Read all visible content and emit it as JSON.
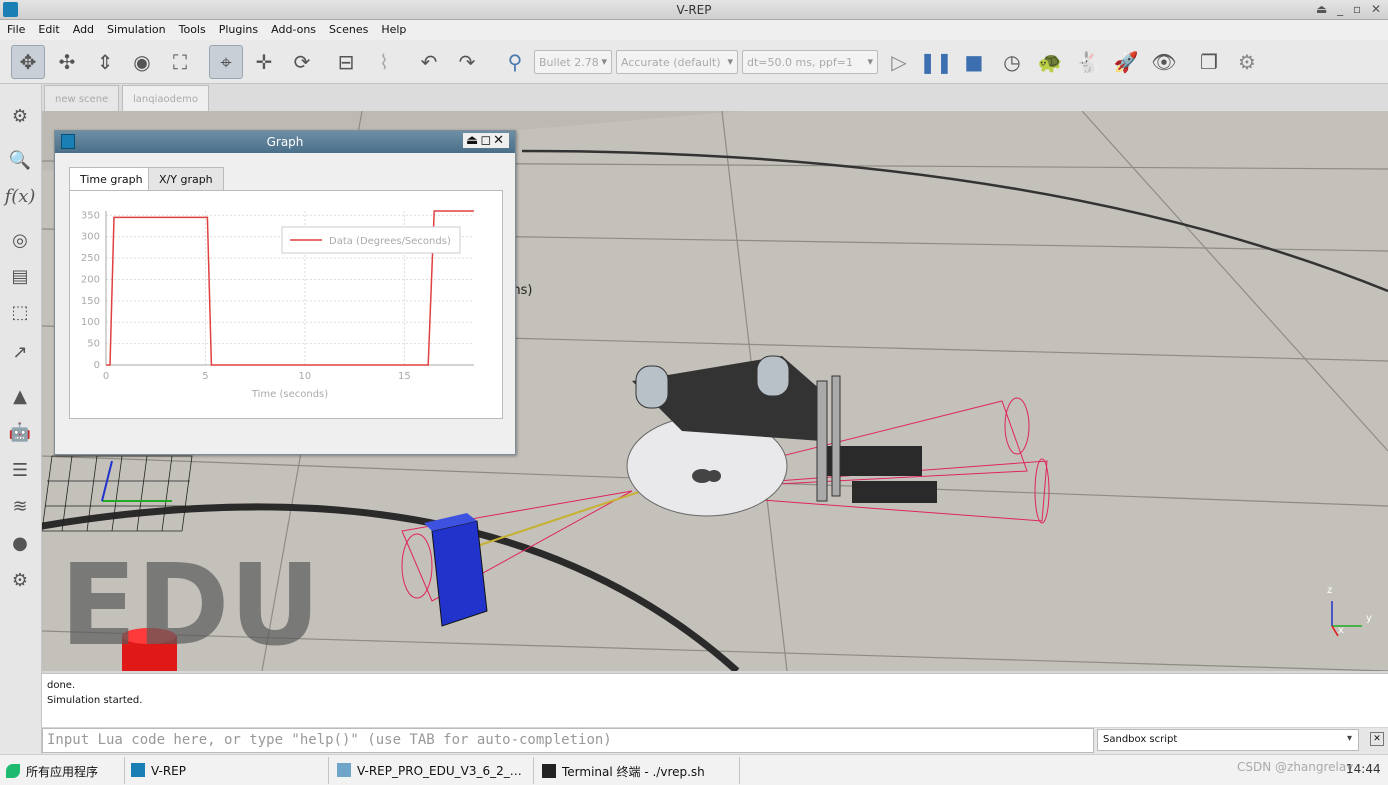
{
  "window": {
    "title": "V-REP"
  },
  "menu": [
    "File",
    "Edit",
    "Add",
    "Simulation",
    "Tools",
    "Plugins",
    "Add-ons",
    "Scenes",
    "Help"
  ],
  "toolbar": {
    "engine": "Bullet 2.78",
    "accuracy": "Accurate (default)",
    "timestep": "dt=50.0 ms, ppf=1"
  },
  "scene_tabs": [
    "new scene",
    "lanqiaodemo"
  ],
  "graph": {
    "title": "Graph",
    "tabs": [
      "Time graph",
      "X/Y graph"
    ],
    "legend": "Data (Degrees/Seconds)",
    "yticks": [
      "350",
      "300",
      "250",
      "200",
      "150",
      "100",
      "50",
      "0"
    ],
    "xticks": [
      "0",
      "5",
      "10",
      "15"
    ],
    "xlabel": "Time (seconds)"
  },
  "chart_data": {
    "type": "line",
    "xlabel": "Time (seconds)",
    "ylabel": "",
    "xlim": [
      0,
      18.5
    ],
    "ylim": [
      0,
      360
    ],
    "series": [
      {
        "name": "Data (Degrees/Seconds)",
        "x": [
          0,
          0.2,
          0.4,
          5.1,
          5.3,
          16.2,
          16.5,
          18.5
        ],
        "y": [
          0,
          0,
          345,
          345,
          0,
          0,
          360,
          360
        ]
      }
    ]
  },
  "scene": {
    "overlay_text": "ms)",
    "watermark": "EDU",
    "axes": [
      "z",
      "y",
      "x"
    ]
  },
  "console": {
    "lines": [
      "done.",
      "Simulation started."
    ]
  },
  "lua": {
    "placeholder": "Input Lua code here, or type \"help()\" (use TAB for auto-completion)",
    "script_type": "Sandbox script"
  },
  "taskbar": {
    "start": "所有应用程序",
    "items": [
      "V-REP",
      "V-REP_PRO_EDU_V3_6_2_…",
      "Terminal 终端 - ./vrep.sh"
    ],
    "watermark": "CSDN @zhangrelay",
    "clock": "14:44"
  },
  "colors": {
    "accent": "#1a7fb5",
    "series": "#e04040",
    "graph_title": "#4a6f88"
  }
}
